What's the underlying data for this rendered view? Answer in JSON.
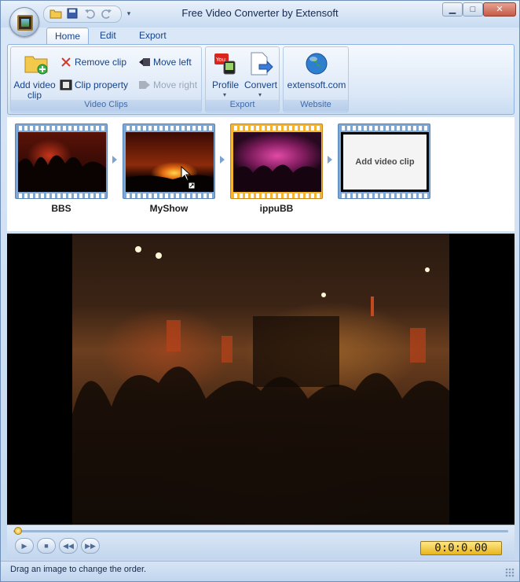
{
  "app": {
    "title": "Free Video Converter by Extensoft"
  },
  "qat": {
    "open": "open-folder-icon",
    "save": "save-icon",
    "undo": "undo-icon",
    "redo": "redo-icon",
    "customize": "▾"
  },
  "window_controls": {
    "minimize": "▁",
    "maximize": "□",
    "close": "✕"
  },
  "tabs": [
    {
      "label": "Home",
      "active": true
    },
    {
      "label": "Edit",
      "active": false
    },
    {
      "label": "Export",
      "active": false
    }
  ],
  "ribbon": {
    "video_clips": {
      "label": "Video Clips",
      "add_video_clip": "Add video clip",
      "remove_clip": "Remove clip",
      "clip_property": "Clip property",
      "move_left": "Move left",
      "move_right": "Move right"
    },
    "export": {
      "label": "Export",
      "profile": "Profile",
      "convert": "Convert"
    },
    "website": {
      "label": "Website",
      "link": "extensoft.com"
    }
  },
  "clips": [
    {
      "name": "BBS",
      "selected": false
    },
    {
      "name": "MyShow",
      "selected": false
    },
    {
      "name": "ippuBB",
      "selected": true
    }
  ],
  "add_clip_placeholder": "Add video clip",
  "player": {
    "time": "0:0:0.00",
    "progress": 0
  },
  "status": {
    "text": "Drag an image to change the order."
  },
  "colors": {
    "accent": "#15428b",
    "selected_clip": "#f6b52e",
    "filmstrip": "#7fa7d3",
    "time_display": "#ffd54a"
  }
}
